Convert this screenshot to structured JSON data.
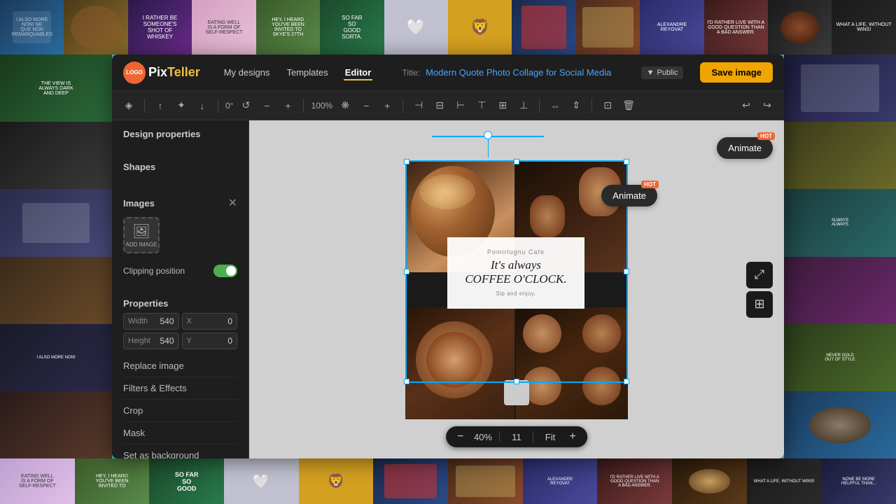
{
  "app": {
    "name": "PixTeller",
    "logo_text_pix": "Pix",
    "logo_text_teller": "Teller",
    "logo_abbrev": "LOGO"
  },
  "nav": {
    "my_designs": "My designs",
    "templates": "Templates",
    "editor": "Editor",
    "title_label": "Title:",
    "title_value": "Modern Quote Photo Collage for Social Media",
    "visibility": "Public",
    "save_button": "Save image"
  },
  "toolbar": {
    "zoom_value": "100%",
    "rotation_value": "0°"
  },
  "left_panel": {
    "design_properties": "Design properties",
    "shapes": "Shapes",
    "images": "Images",
    "add_image": "ADD\nIMAGE",
    "clipping_position": "Clipping position",
    "properties": "Properties",
    "width_label": "Width",
    "width_value": "540",
    "height_label": "Height",
    "height_value": "540",
    "x_label": "X",
    "x_value": "0",
    "y_label": "Y",
    "y_value": "0",
    "replace_image": "Replace image",
    "filters_effects": "Filters & Effects",
    "crop": "Crop",
    "mask": "Mask",
    "set_as_background": "Set as background"
  },
  "canvas": {
    "animate_btn": "Animate",
    "hot_badge": "HOT",
    "cafe_name": "Pomirlugnu Cafe",
    "main_quote_line1": "It's always",
    "main_quote_line2": "COFFEE O'CLOCK.",
    "tagline": "Sip and enjoy."
  },
  "zoom": {
    "value": "40%",
    "page": "11",
    "fit": "Fit"
  },
  "strips": {
    "top": [
      {
        "label": "quote1"
      },
      {
        "label": "photo1"
      },
      {
        "label": "food1"
      },
      {
        "label": "quote2"
      },
      {
        "label": "quote3"
      },
      {
        "label": "social1"
      },
      {
        "label": "heart"
      },
      {
        "label": "lion"
      },
      {
        "label": "card1"
      },
      {
        "label": "card2"
      },
      {
        "label": "card3"
      },
      {
        "label": "card4"
      },
      {
        "label": "card5"
      },
      {
        "label": "card6"
      },
      {
        "label": "promo1"
      },
      {
        "label": "coffee2"
      }
    ],
    "bottom": [
      {
        "label": "food2"
      },
      {
        "label": "food3"
      },
      {
        "label": "quote4"
      },
      {
        "label": "text1"
      },
      {
        "label": "text2"
      },
      {
        "label": "circle1"
      },
      {
        "label": "lion2"
      },
      {
        "label": "card7"
      },
      {
        "label": "card8"
      },
      {
        "label": "card9"
      },
      {
        "label": "promo2"
      },
      {
        "label": "coffee3"
      },
      {
        "label": "photo2"
      },
      {
        "label": "coffee4"
      },
      {
        "label": "quote5"
      },
      {
        "label": "promo3"
      }
    ],
    "left": [
      {
        "label": "plant"
      },
      {
        "label": "view"
      },
      {
        "label": "photo3"
      },
      {
        "label": "photo4"
      },
      {
        "label": "quote6"
      },
      {
        "label": "photo5"
      }
    ],
    "right": [
      {
        "label": "card10"
      },
      {
        "label": "card11"
      },
      {
        "label": "card12"
      },
      {
        "label": "card13"
      },
      {
        "label": "quote7"
      },
      {
        "label": "coffee5"
      }
    ]
  }
}
